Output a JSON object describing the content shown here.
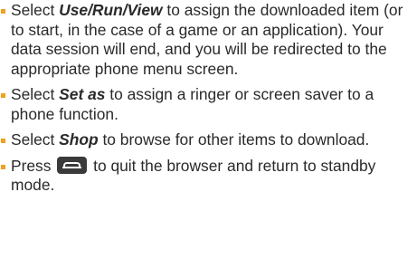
{
  "instructions": [
    {
      "prefix": "Select ",
      "keyword": "Use/Run/View",
      "suffix": " to assign the downloaded item (or to start, in the case of a game or an application). Your data session will end, and you will be redirected to the appropriate phone menu screen."
    },
    {
      "prefix": "Select ",
      "keyword": "Set as",
      "suffix": " to assign a ringer or screen saver to a phone function."
    },
    {
      "prefix": "Select ",
      "keyword": "Shop",
      "suffix": " to browse for other items to download."
    },
    {
      "prefix": "Press ",
      "key_icon": "end-call-key-icon",
      "suffix": " to quit the browser and return to standby mode."
    }
  ],
  "colors": {
    "bullet": "#f0a020",
    "text": "#2a2a2a",
    "key_background": "#3a3a3a"
  }
}
